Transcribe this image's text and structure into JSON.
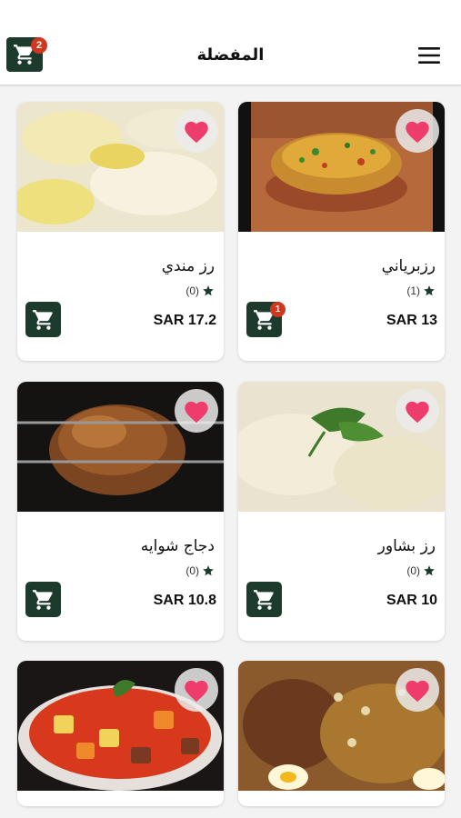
{
  "app_bar": {
    "title": "المفضلة",
    "cart_count": "2",
    "cart_icon": "cart-icon",
    "menu_icon": "menu-icon"
  },
  "colors": {
    "primary": "#1c3b2d",
    "badge": "#d0371f",
    "heart": "#ee3d6d"
  },
  "items": [
    {
      "name": "رزبرياني",
      "rating_count": "(1)",
      "price": "SAR 13",
      "cart_count": "1",
      "image": "biryani-rice-bowl"
    },
    {
      "name": "رز مندي",
      "rating_count": "(0)",
      "price": "SAR 17.2",
      "image": "mandi-rice"
    },
    {
      "name": "رز بشاور",
      "rating_count": "(0)",
      "price": "SAR 10",
      "image": "plain-rice-with-parsley"
    },
    {
      "name": "دجاج شوايه",
      "rating_count": "(0)",
      "price": "SAR 10.8",
      "image": "rotisserie-chicken"
    },
    {
      "name": "",
      "image": "rice-with-chicken-and-nuts"
    },
    {
      "name": "",
      "image": "vegetable-meat-stew"
    }
  ]
}
